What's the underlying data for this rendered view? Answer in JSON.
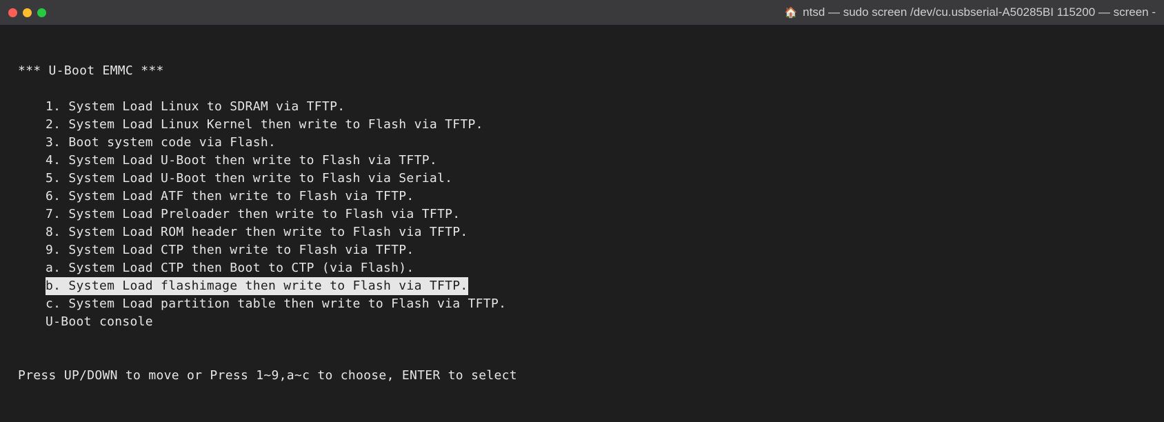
{
  "titlebar": {
    "title": "ntsd — sudo screen /dev/cu.usbserial-A50285BI 115200 — screen -"
  },
  "terminal": {
    "header": "*** U-Boot EMMC ***",
    "menu_items": [
      {
        "key": "1",
        "label": "System Load Linux to SDRAM via TFTP.",
        "selected": false
      },
      {
        "key": "2",
        "label": "System Load Linux Kernel then write to Flash via TFTP.",
        "selected": false
      },
      {
        "key": "3",
        "label": "Boot system code via Flash.",
        "selected": false
      },
      {
        "key": "4",
        "label": "System Load U-Boot then write to Flash via TFTP.",
        "selected": false
      },
      {
        "key": "5",
        "label": "System Load U-Boot then write to Flash via Serial.",
        "selected": false
      },
      {
        "key": "6",
        "label": "System Load ATF then write to Flash via TFTP.",
        "selected": false
      },
      {
        "key": "7",
        "label": "System Load Preloader then write to Flash via TFTP.",
        "selected": false
      },
      {
        "key": "8",
        "label": "System Load ROM header then write to Flash via TFTP.",
        "selected": false
      },
      {
        "key": "9",
        "label": "System Load CTP then write to Flash via TFTP.",
        "selected": false
      },
      {
        "key": "a",
        "label": "System Load CTP then Boot to CTP (via Flash).",
        "selected": false
      },
      {
        "key": "b",
        "label": "System Load flashimage then write to Flash via TFTP.",
        "selected": true
      },
      {
        "key": "c",
        "label": "System Load partition table then write to Flash via TFTP.",
        "selected": false
      }
    ],
    "console_label": "U-Boot console",
    "footer": "Press UP/DOWN to move or Press 1~9,a~c to choose, ENTER to select"
  }
}
